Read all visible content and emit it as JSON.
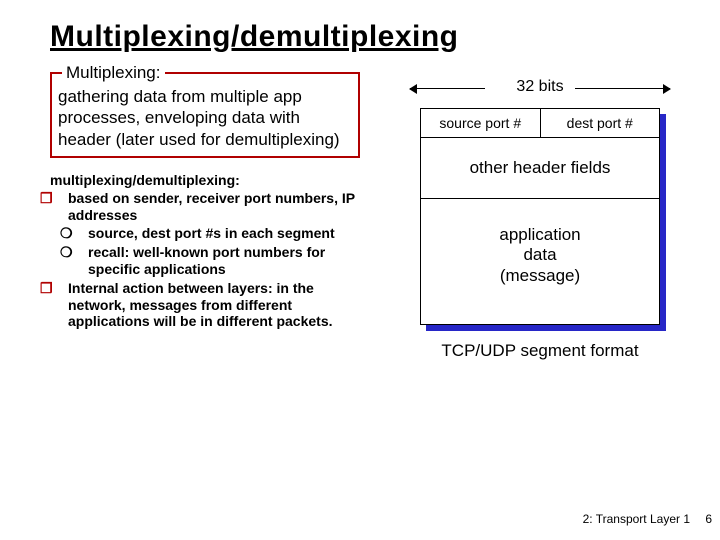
{
  "title": "Multiplexing/demultiplexing",
  "defbox": {
    "legend": "Multiplexing:",
    "body": "gathering data from multiple app processes, enveloping data with header (later used for demultiplexing)"
  },
  "list": {
    "head": "multiplexing/demultiplexing:",
    "b1a": "based on sender, receiver port numbers, IP addresses",
    "b2a": "source, dest port #s in each segment",
    "b2b": "recall: well-known port numbers for specific applications",
    "b1b": "Internal action between layers:  in the network, messages from different applications will be in different packets."
  },
  "diagram": {
    "bits": "32 bits",
    "src": "source port #",
    "dst": "dest port #",
    "other": "other header fields",
    "app": "application\ndata\n(message)",
    "caption": "TCP/UDP segment format"
  },
  "footer": "2: Transport Layer 1",
  "page": "6"
}
